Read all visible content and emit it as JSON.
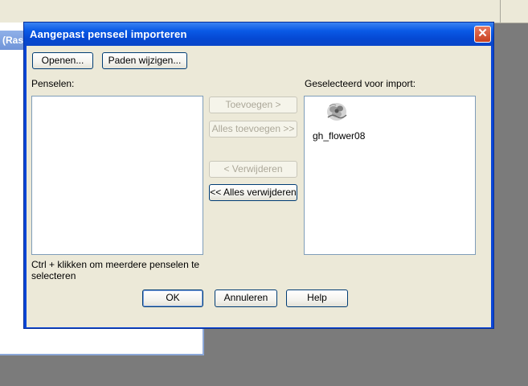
{
  "background": {
    "tab_label": "(Ras"
  },
  "dialog": {
    "title": "Aangepast penseel importeren",
    "close_symbol": "✕",
    "open_button": "Openen...",
    "paths_button": "Paden wijzigen...",
    "brushes_label": "Penselen:",
    "selected_label": "Geselecteerd voor import:",
    "add_button": "Toevoegen >",
    "add_all_button": "Alles toevoegen >>",
    "remove_button": "< Verwijderen",
    "remove_all_button": "<< Alles verwijderen",
    "selected_items": [
      {
        "name": "gh_flower08",
        "icon": "brush-thumbnail-icon"
      }
    ],
    "hint_text": "Ctrl + klikken om meerdere penselen te selecteren",
    "ok_button": "OK",
    "cancel_button": "Annuleren",
    "help_button": "Help"
  },
  "colors": {
    "title_bar": "#0a5ae6",
    "dialog_face": "#ece9d8",
    "close_button": "#d9552f",
    "list_border": "#7f9db9"
  }
}
